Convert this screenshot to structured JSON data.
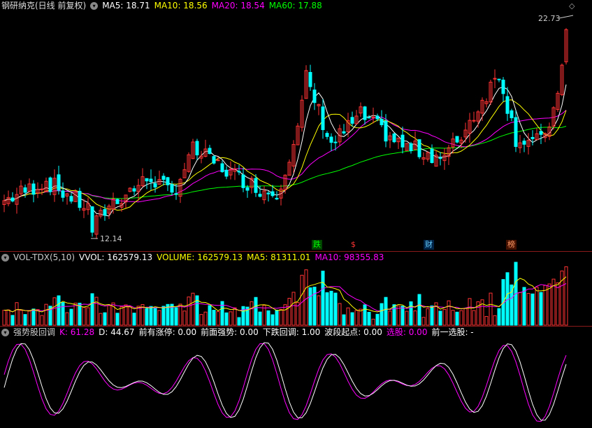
{
  "price_pane": {
    "title": "钢研纳克(日线 前复权)",
    "indicators": [
      {
        "label": "MA5: 18.71",
        "color": "#ffffff"
      },
      {
        "label": "MA10: 18.56",
        "color": "#ffff00"
      },
      {
        "label": "MA20: 18.54",
        "color": "#ff00ff"
      },
      {
        "label": "MA60: 17.88",
        "color": "#00ff00"
      }
    ],
    "high_label": "22.73",
    "low_label": "12.14",
    "event_tags": [
      {
        "label": "跌",
        "color": "#00ff00",
        "bg": "#004400"
      },
      {
        "label": "$",
        "color": "#ff3333",
        "bg": "#000000"
      },
      {
        "label": "财",
        "color": "#66ccff",
        "bg": "#002244"
      },
      {
        "label": "榜",
        "color": "#ff9966",
        "bg": "#441100"
      }
    ]
  },
  "volume_pane": {
    "items": [
      {
        "label": "VOL-TDX(5,10)",
        "color": "#cccccc"
      },
      {
        "label": "VVOL: 162579.13",
        "color": "#ffffff"
      },
      {
        "label": "VOLUME: 162579.13",
        "color": "#ffff00"
      },
      {
        "label": "MA5: 81311.01",
        "color": "#ffff00"
      },
      {
        "label": "MA10: 98355.83",
        "color": "#ff00ff"
      }
    ]
  },
  "osc_pane": {
    "items": [
      {
        "label": "强势股回调",
        "color": "#cccccc"
      },
      {
        "label": "K: 61.28",
        "color": "#ff00ff"
      },
      {
        "label": "D: 44.67",
        "color": "#ffffff"
      },
      {
        "label": "前有涨停: 0.00",
        "color": "#ffffff"
      },
      {
        "label": "前面强势: 0.00",
        "color": "#ffffff"
      },
      {
        "label": "下跌回调: 1.00",
        "color": "#ffffff"
      },
      {
        "label": "波段起点: 0.00",
        "color": "#ffffff"
      },
      {
        "label": "选股: 0.00",
        "color": "#ff00ff"
      },
      {
        "label": "前一选股: -",
        "color": "#ffffff"
      }
    ]
  },
  "colors": {
    "up": "#ff3333",
    "down": "#00ffff",
    "ma5": "#ffffff",
    "ma10": "#ffff00",
    "ma20": "#ff00ff",
    "ma60": "#00ff00"
  }
}
